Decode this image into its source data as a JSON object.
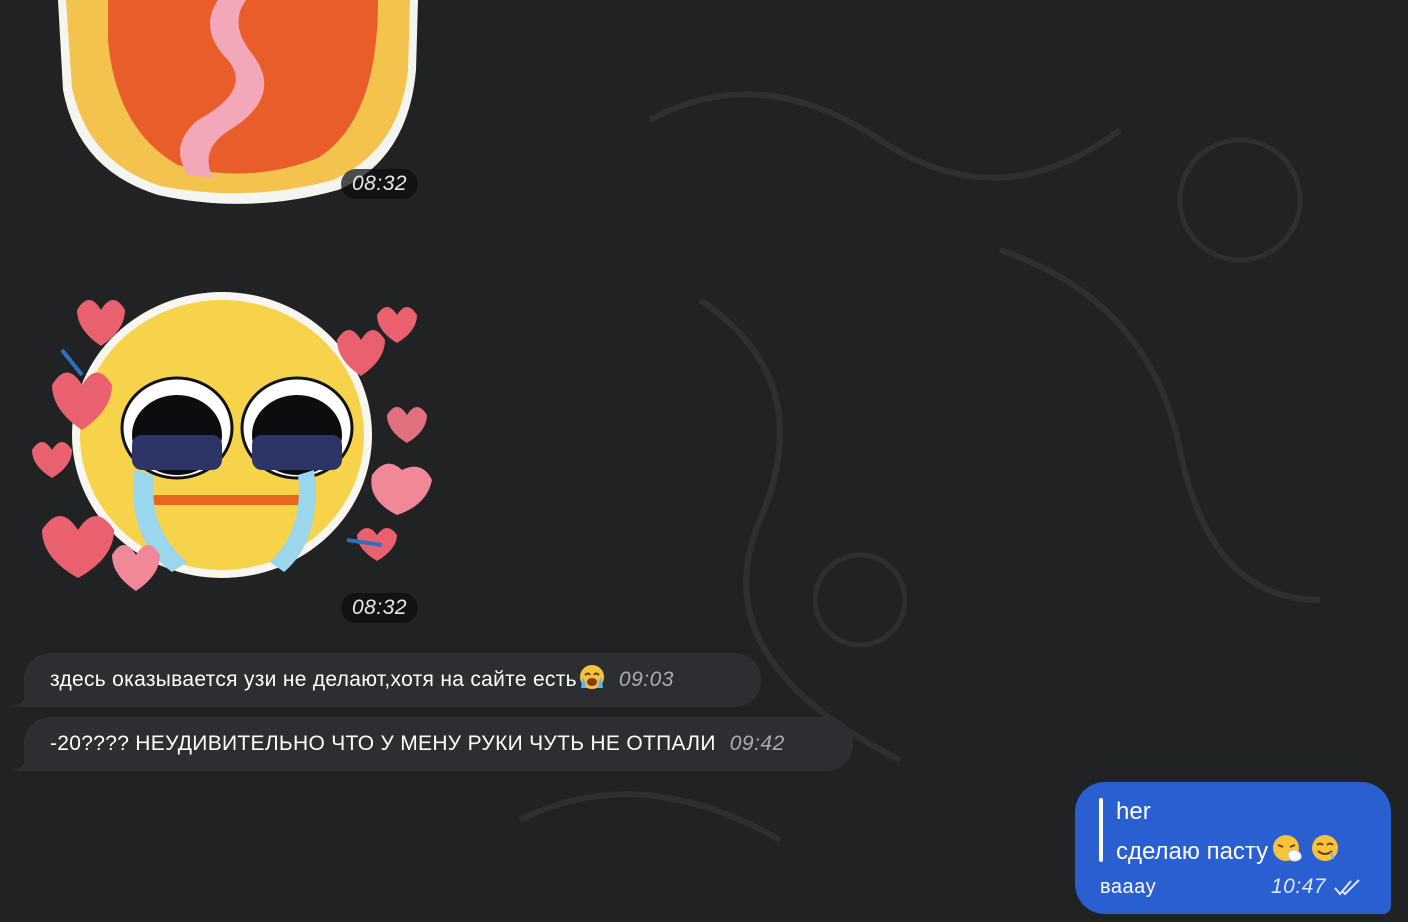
{
  "chat": {
    "background_color": "#212224",
    "messages": [
      {
        "kind": "sticker",
        "sticker_icon": "crying-emoji-tongue-sticker",
        "time": "08:32"
      },
      {
        "kind": "sticker",
        "sticker_icon": "teary-emoji-hearts-sticker",
        "time": "08:32"
      },
      {
        "kind": "text",
        "direction": "incoming",
        "text": "здесь оказывается узи не делают,хотя на сайте есть",
        "emoji": "loudly-crying-face-icon",
        "time": "09:03"
      },
      {
        "kind": "text",
        "direction": "incoming",
        "text": "-20???? НЕУДИВИТЕЛЬНО ЧТО У МЕНУ РУКИ ЧУТЬ НЕ ОТПАЛИ",
        "time": "09:42"
      },
      {
        "kind": "reply",
        "direction": "outgoing",
        "reply_author": "her",
        "reply_text": "сделаю пасту",
        "reply_emojis": [
          "sneezing-face-icon",
          "drooling-smile-face-icon"
        ],
        "text": "ваааy",
        "time": "10:47",
        "status": "read-double-check-icon"
      }
    ]
  },
  "colors": {
    "incoming_bubble": "#2d2e31",
    "outgoing_bubble": "#2a5fd1",
    "time_incoming": "#a9acb3"
  }
}
